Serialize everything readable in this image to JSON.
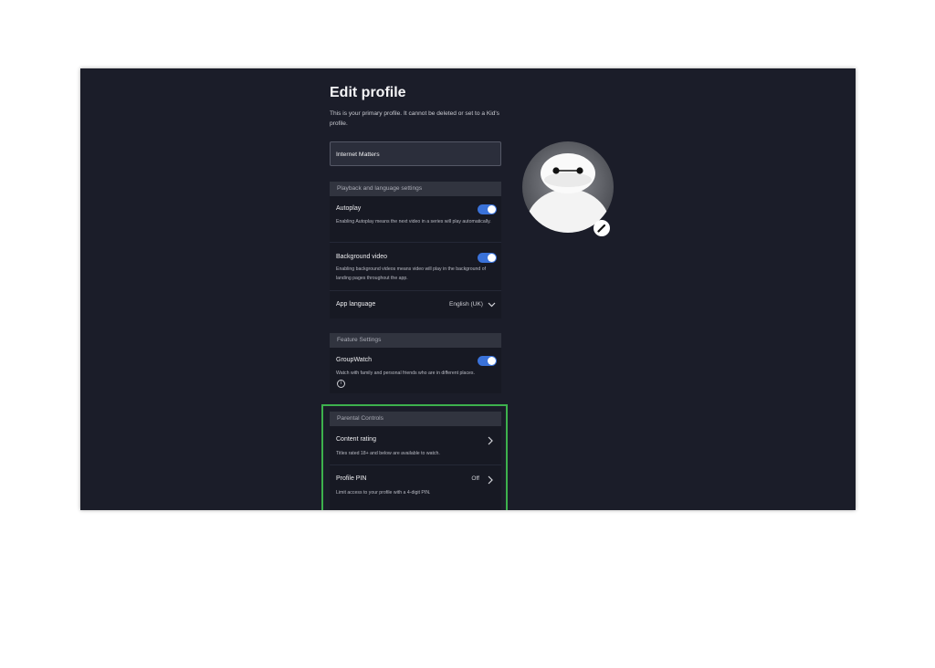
{
  "page": {
    "title": "Edit profile",
    "subtitle": "This is your primary profile. It cannot be deleted or set to a Kid's profile.",
    "profile_name": "Internet Matters"
  },
  "playback": {
    "header": "Playback and language settings",
    "autoplay": {
      "title": "Autoplay",
      "desc": "Enabling Autoplay means the next video in a series will play automatically.",
      "enabled": true
    },
    "background_video": {
      "title": "Background video",
      "desc": "Enabling background videos means video will play in the background of landing pages throughout the app.",
      "enabled": true
    },
    "app_language": {
      "title": "App language",
      "value": "English (UK)"
    }
  },
  "features": {
    "header": "Feature Settings",
    "groupwatch": {
      "title": "GroupWatch",
      "desc": "Watch with family and personal friends who are in different places.",
      "enabled": true
    }
  },
  "parental": {
    "header": "Parental Controls",
    "content_rating": {
      "title": "Content rating",
      "desc": "Titles rated 18+ and below are available to watch."
    },
    "profile_pin": {
      "title": "Profile PIN",
      "value": "Off",
      "desc": "Limit access to your profile with a 4-digit PIN."
    }
  },
  "colors": {
    "background": "#1b1d29",
    "toggle_on": "#3a72d9",
    "highlight": "#3db14d"
  },
  "icons": [
    "chevron-down-icon",
    "chevron-right-icon",
    "info-icon",
    "edit-pencil-icon"
  ]
}
